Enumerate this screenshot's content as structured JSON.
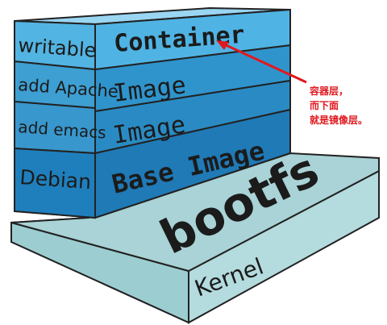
{
  "layers": {
    "container": {
      "side_label": "writable",
      "front_label": "Container"
    },
    "image_apache": {
      "side_label": "add Apache",
      "front_label": "Image"
    },
    "image_emacs": {
      "side_label": "add emacs",
      "front_label": "Image"
    },
    "base": {
      "side_label": "Debian",
      "front_label": "Base Image"
    },
    "bootfs": {
      "label": "bootfs"
    },
    "kernel": {
      "label": "Kernel"
    }
  },
  "annotation": {
    "lines": [
      "容器层，",
      "而下面",
      "就是镜像层。"
    ],
    "color": "#e0191f"
  },
  "colors": {
    "container_front": "#4fb4e4",
    "container_top": "#9ad6f2",
    "image_front": "#2c8fc8",
    "base_front": "#1e78b4",
    "side": "#3d9fd2",
    "bootfs": "#a9d3d6",
    "kernel": "#b8dde0"
  }
}
